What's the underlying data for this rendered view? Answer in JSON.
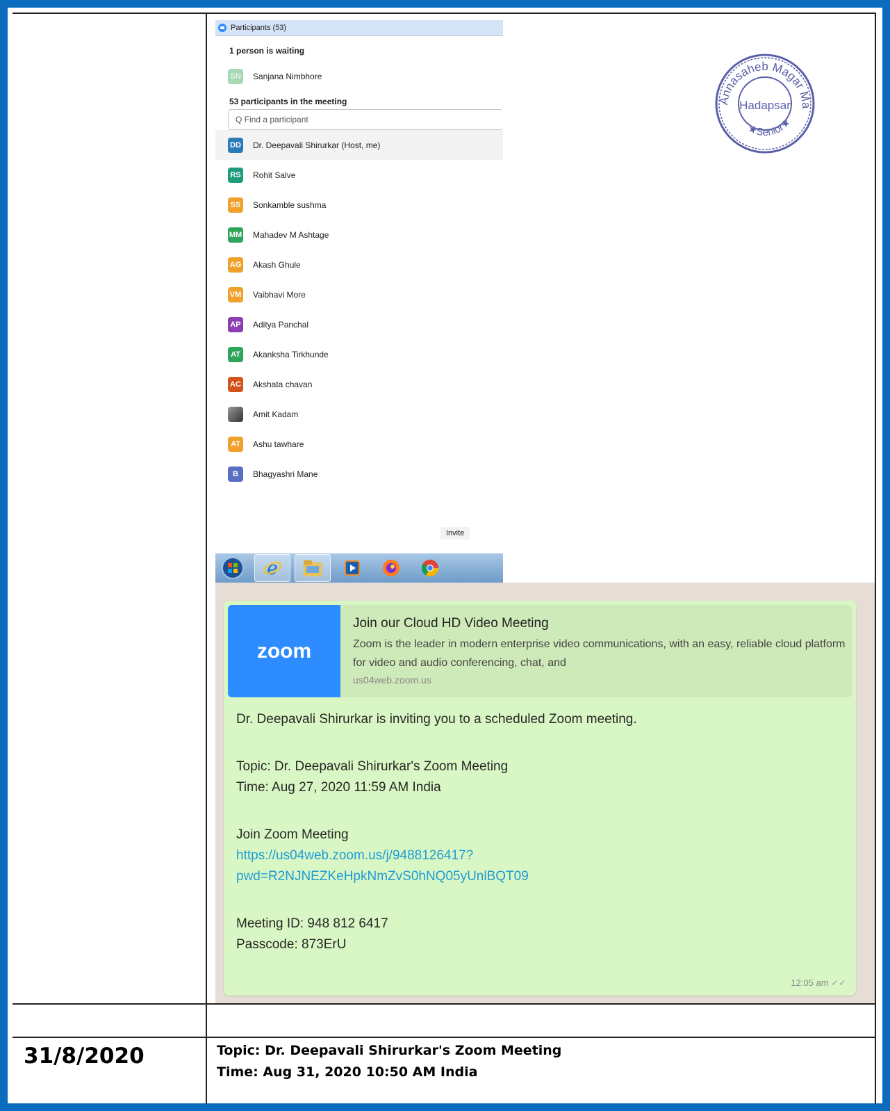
{
  "zoom_panel": {
    "title": "Participants (53)",
    "waiting_heading": "1 person is waiting",
    "waiting_person": {
      "initials": "SN",
      "name": "Sanjana Nimbhore",
      "color": "#a8d9b5"
    },
    "meeting_heading": "53 participants in the meeting",
    "search_placeholder": "Q Find a participant",
    "participants": [
      {
        "initials": "DD",
        "name": "Dr. Deepavali Shirurkar (Host, me)",
        "color": "#2b7bb9"
      },
      {
        "initials": "RS",
        "name": "Rohit Salve",
        "color": "#1e9c7c"
      },
      {
        "initials": "SS",
        "name": "Sonkamble sushma",
        "color": "#f0a12b"
      },
      {
        "initials": "MM",
        "name": "Mahadev M Ashtage",
        "color": "#2ea55a"
      },
      {
        "initials": "AG",
        "name": "Akash Ghule",
        "color": "#f0a12b"
      },
      {
        "initials": "VM",
        "name": "Vaibhavi More",
        "color": "#f0a12b"
      },
      {
        "initials": "AP",
        "name": "Aditya Panchal",
        "color": "#8b3fb0"
      },
      {
        "initials": "AT",
        "name": "Akanksha Tirkhunde",
        "color": "#2ea55a"
      },
      {
        "initials": "AC",
        "name": "Akshata chavan",
        "color": "#d3531a"
      },
      {
        "initials": "",
        "name": "Amit Kadam",
        "color": "#777777"
      },
      {
        "initials": "AT",
        "name": "Ashu tawhare",
        "color": "#f0a12b"
      },
      {
        "initials": "B",
        "name": "Bhagyashri Mane",
        "color": "#5a6fc4"
      }
    ],
    "invite_label": "Invite"
  },
  "taskbar": {
    "icons": [
      "windows-start-icon",
      "internet-explorer-icon",
      "file-explorer-icon",
      "media-player-icon",
      "firefox-icon",
      "chrome-icon"
    ]
  },
  "seal": {
    "line1": "Annasaheb Magar Mahavidyalaya",
    "line2": "Hadapsar",
    "line3": "Senior"
  },
  "whatsapp": {
    "preview_logo": "zoom",
    "preview_title": "Join our Cloud HD Video Meeting",
    "preview_desc": "Zoom is the leader in modern enterprise video communications, with an easy, reliable cloud platform for video and audio conferencing, chat, and",
    "preview_url": "us04web.zoom.us",
    "invite_line": "Dr. Deepavali Shirurkar is inviting you to a scheduled Zoom meeting.",
    "topic": "Topic: Dr. Deepavali Shirurkar's Zoom Meeting",
    "time": "Time: Aug 27, 2020 11:59 AM India",
    "join_heading": "Join Zoom Meeting",
    "join_link_1": "https://us04web.zoom.us/j/9488126417?",
    "join_link_2": "pwd=R2NJNEZKeHpkNmZvS0hNQ05yUnlBQT09",
    "meeting_id": "Meeting ID: 948 812 6417",
    "passcode": "Passcode: 873ErU",
    "timestamp": "12:05 am"
  },
  "row2": {
    "date": "31/8/2020",
    "topic": "Topic: Dr. Deepavali Shirurkar's Zoom Meeting",
    "time": "Time: Aug 31, 2020 10:50 AM India"
  }
}
